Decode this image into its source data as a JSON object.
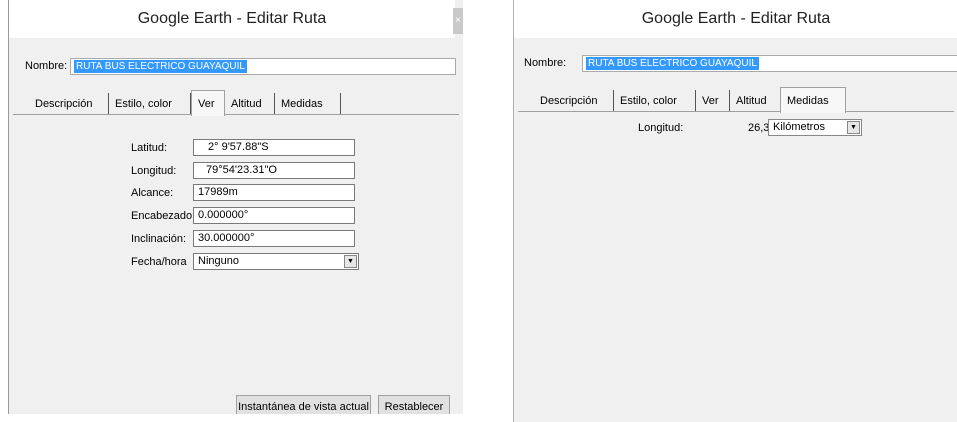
{
  "left_dialog": {
    "title": "Google Earth - Editar Ruta",
    "close_glyph": "×",
    "name_label": "Nombre:",
    "name_value": "RUTA BUS ELECTRICO GUAYAQUIL",
    "tabs": [
      {
        "label": "Descripción",
        "active": false
      },
      {
        "label": "Estilo, color",
        "active": false
      },
      {
        "label": "Ver",
        "active": true
      },
      {
        "label": "Altitud",
        "active": false
      },
      {
        "label": "Medidas",
        "active": false
      }
    ],
    "fields": {
      "latitud": {
        "label": "Latitud:",
        "value": "2° 9'57.88\"S"
      },
      "longitud": {
        "label": "Longitud:",
        "value": "79°54'23.31\"O"
      },
      "alcance": {
        "label": "Alcance:",
        "value": "17989m"
      },
      "encabezado": {
        "label": "Encabezado:",
        "value": "0.000000°"
      },
      "inclinacion": {
        "label": "Inclinación:",
        "value": "30.000000°"
      },
      "fecha": {
        "label": "Fecha/hora",
        "value": "Ninguno"
      }
    },
    "buttons": {
      "snapshot": "Instantánea de vista actual",
      "reset": "Restablecer"
    }
  },
  "right_dialog": {
    "title": "Google Earth - Editar Ruta",
    "name_label": "Nombre:",
    "name_value": "RUTA BUS ELECTRICO GUAYAQUIL",
    "tabs": [
      {
        "label": "Descripción",
        "active": false
      },
      {
        "label": "Estilo, color",
        "active": false
      },
      {
        "label": "Ver",
        "active": false
      },
      {
        "label": "Altitud",
        "active": false
      },
      {
        "label": "Medidas",
        "active": true
      }
    ],
    "longitud": {
      "label": "Longitud:",
      "value": "26,3",
      "unit": "Kilómetros"
    }
  }
}
